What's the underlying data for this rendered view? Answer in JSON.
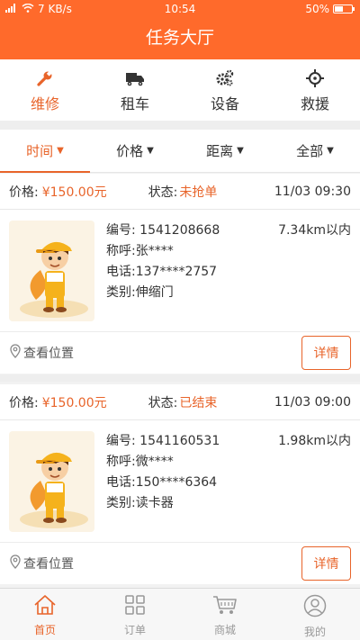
{
  "status_bar": {
    "network_speed": "7 KB/s",
    "time": "10:54",
    "battery": "50%"
  },
  "navbar": {
    "title": "任务大厅"
  },
  "categories": [
    {
      "label": "维修",
      "icon": "wrench-icon",
      "active": true
    },
    {
      "label": "租车",
      "icon": "truck-icon",
      "active": false
    },
    {
      "label": "设备",
      "icon": "gears-icon",
      "active": false
    },
    {
      "label": "救援",
      "icon": "crosshair-icon",
      "active": false
    }
  ],
  "filters": [
    {
      "label": "时间",
      "active": true
    },
    {
      "label": "价格",
      "active": false
    },
    {
      "label": "距离",
      "active": false
    },
    {
      "label": "全部",
      "active": false
    }
  ],
  "orders": [
    {
      "price_label": "价格:",
      "price": "¥150.00元",
      "status_label": "状态:",
      "status": "未抢单",
      "date": "11/03 09:30",
      "number_label": "编号:",
      "number": "1541208668",
      "distance": "7.34km以内",
      "name_label": "称呼:",
      "name": "张****",
      "phone_label": "电话:",
      "phone": "137****2757",
      "type_label": "类别:",
      "type": "伸缩门",
      "location": "查看位置",
      "detail": "详情"
    },
    {
      "price_label": "价格:",
      "price": "¥150.00元",
      "status_label": "状态:",
      "status": "已结束",
      "date": "11/03 09:00",
      "number_label": "编号:",
      "number": "1541160531",
      "distance": "1.98km以内",
      "name_label": "称呼:",
      "name": "微****",
      "phone_label": "电话:",
      "phone": "150****6364",
      "type_label": "类别:",
      "type": "读卡器",
      "location": "查看位置",
      "detail": "详情"
    }
  ],
  "tabbar": [
    {
      "label": "首页",
      "icon": "home-icon",
      "active": true
    },
    {
      "label": "订单",
      "icon": "grid-icon",
      "active": false
    },
    {
      "label": "商城",
      "icon": "cart-icon",
      "active": false
    },
    {
      "label": "我的",
      "icon": "user-icon",
      "active": false
    }
  ],
  "colors": {
    "brand": "#ff6a2b",
    "accent": "#e8642a"
  }
}
